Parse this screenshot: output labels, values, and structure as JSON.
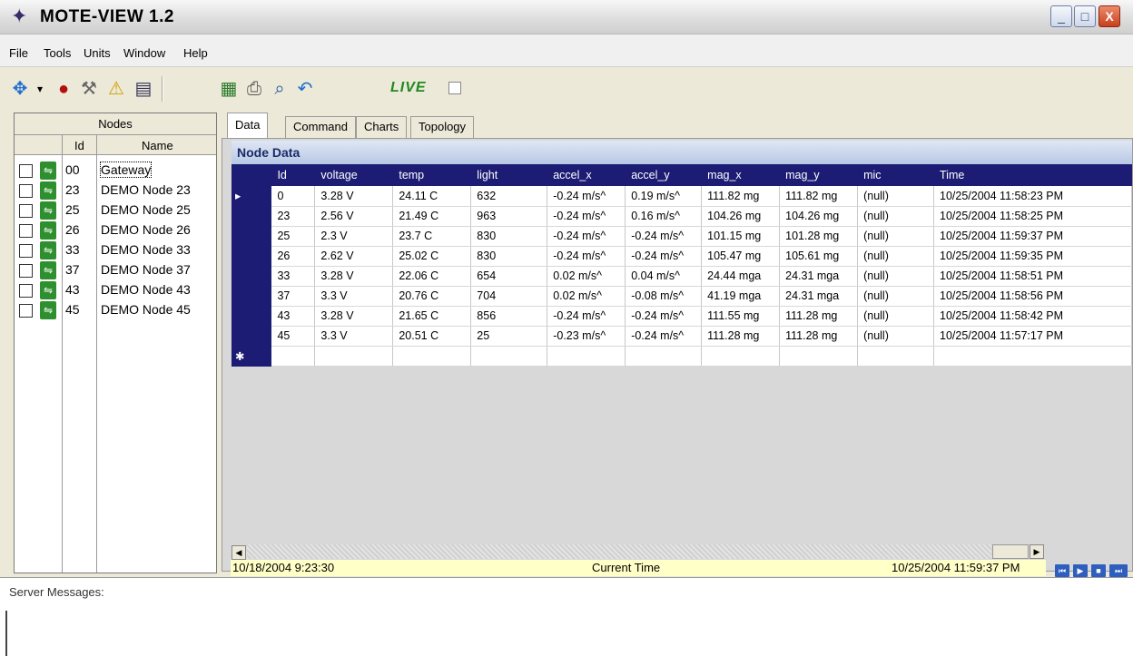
{
  "window": {
    "title": "MOTE-VIEW 1.2",
    "minimize": "_",
    "maximize": "□",
    "close": "X"
  },
  "menu": [
    "File",
    "Tools",
    "Units",
    "Window",
    "Help"
  ],
  "toolbar": {
    "live_label": "LIVE"
  },
  "nodes_panel": {
    "title": "Nodes",
    "col_id": "Id",
    "col_name": "Name",
    "items": [
      {
        "id": "00",
        "name": "Gateway"
      },
      {
        "id": "23",
        "name": "DEMO Node 23"
      },
      {
        "id": "25",
        "name": "DEMO Node 25"
      },
      {
        "id": "26",
        "name": "DEMO Node 26"
      },
      {
        "id": "33",
        "name": "DEMO Node 33"
      },
      {
        "id": "37",
        "name": "DEMO Node 37"
      },
      {
        "id": "43",
        "name": "DEMO Node 43"
      },
      {
        "id": "45",
        "name": "DEMO Node 45"
      }
    ]
  },
  "tabs": [
    "Data",
    "Command",
    "Charts",
    "Topology"
  ],
  "grid": {
    "caption": "Node Data",
    "columns": [
      "Id",
      "voltage",
      "temp",
      "light",
      "accel_x",
      "accel_y",
      "mag_x",
      "mag_y",
      "mic",
      "Time"
    ],
    "rows": [
      [
        "0",
        "3.28 V",
        "24.11 C",
        "632",
        "-0.24 m/s^",
        "0.19 m/s^",
        "111.82 mg",
        "111.82 mg",
        "(null)",
        "10/25/2004 11:58:23 PM"
      ],
      [
        "23",
        "2.56 V",
        "21.49 C",
        "963",
        "-0.24 m/s^",
        "0.16 m/s^",
        "104.26 mg",
        "104.26 mg",
        "(null)",
        "10/25/2004 11:58:25 PM"
      ],
      [
        "25",
        "2.3 V",
        "23.7 C",
        "830",
        "-0.24 m/s^",
        "-0.24 m/s^",
        "101.15 mg",
        "101.28 mg",
        "(null)",
        "10/25/2004 11:59:37 PM"
      ],
      [
        "26",
        "2.62 V",
        "25.02 C",
        "830",
        "-0.24 m/s^",
        "-0.24 m/s^",
        "105.47 mg",
        "105.61 mg",
        "(null)",
        "10/25/2004 11:59:35 PM"
      ],
      [
        "33",
        "3.28 V",
        "22.06 C",
        "654",
        "0.02 m/s^",
        "0.04 m/s^",
        "24.44 mga",
        "24.31 mga",
        "(null)",
        "10/25/2004 11:58:51 PM"
      ],
      [
        "37",
        "3.3 V",
        "20.76 C",
        "704",
        "0.02 m/s^",
        "-0.08 m/s^",
        "41.19 mga",
        "24.31 mga",
        "(null)",
        "10/25/2004 11:58:56 PM"
      ],
      [
        "43",
        "3.28 V",
        "21.65 C",
        "856",
        "-0.24 m/s^",
        "-0.24 m/s^",
        "111.55 mg",
        "111.28 mg",
        "(null)",
        "10/25/2004 11:58:42 PM"
      ],
      [
        "45",
        "3.3 V",
        "20.51 C",
        "25",
        "-0.23 m/s^",
        "-0.24 m/s^",
        "111.28 mg",
        "111.28 mg",
        "(null)",
        "10/25/2004 11:57:17 PM"
      ]
    ],
    "row_selector": "▸",
    "new_row_marker": "✱"
  },
  "status": {
    "start": "10/18/2004 9:23:30",
    "current_label": "Current Time",
    "end": "10/25/2004 11:59:37 PM"
  },
  "server": {
    "label": "Server Messages:"
  },
  "icons": {
    "app": "mote-icon",
    "toolbar": [
      "network-icon",
      "dropdown-arrow-icon",
      "traffic-light-icon",
      "tools-icon",
      "alert-icon",
      "display-icon",
      "export-icon",
      "print-icon",
      "preview-icon",
      "undo-icon"
    ]
  },
  "colors": {
    "grid_header": "#1c1c74",
    "live": "#1f8a1f",
    "status_bar": "#ffffc8"
  }
}
